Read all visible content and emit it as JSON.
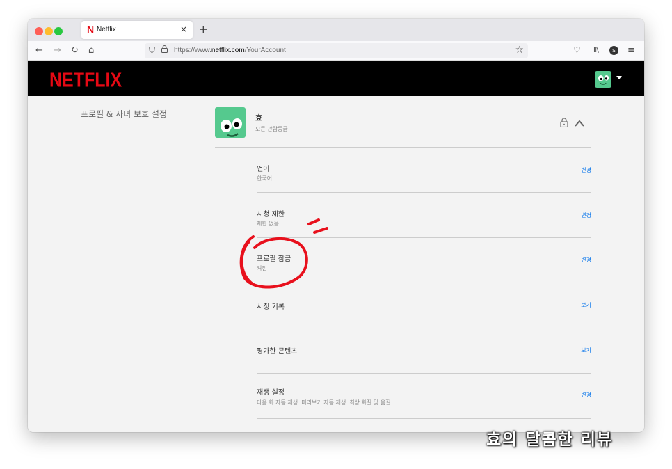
{
  "browser": {
    "tab_title": "Netflix",
    "tab_favicon": "N",
    "close_glyph": "×",
    "newtab_glyph": "+",
    "url_prefix": "https://www.",
    "url_domain": "netflix.com",
    "url_path": "/YourAccount",
    "extension_badge": "$"
  },
  "header": {
    "logo": "NETFLIX"
  },
  "profile_section": {
    "label": "프로필 & 자녀 보호 설정",
    "profile_name": "효",
    "rating": "모든 관람등급"
  },
  "settings": [
    {
      "title": "언어",
      "desc": "한국어",
      "action": "변경"
    },
    {
      "title": "시청 제한",
      "desc": "제한 없음.",
      "action": "변경"
    },
    {
      "title": "프로필 잠금",
      "desc": "켜짐",
      "action": "변경"
    },
    {
      "title": "시청 기록",
      "desc": "",
      "action": "보기"
    },
    {
      "title": "평가한 콘텐츠",
      "desc": "",
      "action": "보기"
    },
    {
      "title": "재생 설정",
      "desc": "다음 화 자동 재생. 미리보기 자동 재생. 최상 화질 및 음질.",
      "action": "변경"
    }
  ],
  "watermark": "효의 달콤한 리뷰",
  "colors": {
    "netflix_red": "#e50914",
    "link_blue": "#0071eb",
    "avatar_green": "#55c98e",
    "annotation_red": "#e8101c"
  }
}
